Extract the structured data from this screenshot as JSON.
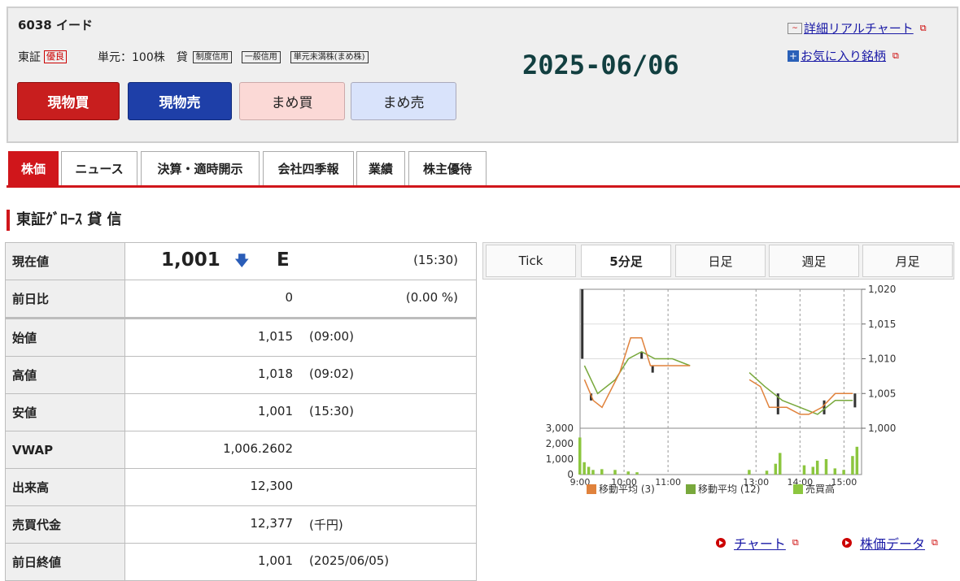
{
  "stock": {
    "code_name": "6038 イード",
    "market": "東証",
    "market_tag": "優良",
    "unit": "単元：100株",
    "lend_label": "貸",
    "tags": [
      "制度信用",
      "一般信用",
      "単元未満株(まめ株)"
    ]
  },
  "buttons": {
    "genbutsu_buy": "現物買",
    "genbutsu_sell": "現物売",
    "mame_buy": "まめ買",
    "mame_sell": "まめ売"
  },
  "date_stamp": "2025-06/06",
  "links": {
    "realtime_chart": "詳細リアルチャート",
    "favorite": "お気に入り銘柄",
    "chart": "チャート",
    "price_data": "株価データ"
  },
  "tabs": [
    "株価",
    "ニュース",
    "決算・適時開示",
    "会社四季報",
    "業績",
    "株主優待"
  ],
  "section_heading": "東証ｸﾞﾛｰｽ 貸 信",
  "quote": {
    "current": {
      "label": "現在値",
      "value": "1,001",
      "flag": "E",
      "time": "(15:30)"
    },
    "change": {
      "label": "前日比",
      "value": "0",
      "pct": "(0.00 %)"
    },
    "rows": [
      {
        "label": "始値",
        "value": "1,015",
        "paren": "(09:00)"
      },
      {
        "label": "高値",
        "value": "1,018",
        "paren": "(09:02)"
      },
      {
        "label": "安値",
        "value": "1,001",
        "paren": "(15:30)"
      },
      {
        "label": "VWAP",
        "value": "1,006.2602",
        "paren": ""
      },
      {
        "label": "出来高",
        "value": "12,300",
        "paren": ""
      },
      {
        "label": "売買代金",
        "value": "12,377",
        "paren": "(千円)"
      },
      {
        "label": "前日終値",
        "value": "1,001",
        "paren": "(2025/06/05)"
      }
    ]
  },
  "chart_tabs": [
    "Tick",
    "5分足",
    "日足",
    "週足",
    "月足"
  ],
  "chart_data": {
    "type": "line",
    "price_axis_ticks": [
      "1,020",
      "1,015",
      "1,010",
      "1,005",
      "1,000"
    ],
    "volume_axis_ticks": [
      "3,000",
      "2,000",
      "1,000",
      "0"
    ],
    "x_ticks": [
      "9:00",
      "10:00",
      "11:00",
      "13:00",
      "14:00",
      "15:00"
    ],
    "legend": [
      "移動平均 (3)",
      "移動平均 (12)",
      "売買高"
    ],
    "colors": {
      "ma3": "#e0823c",
      "ma12": "#78a83c",
      "volume": "#8cc63f"
    },
    "ylim_price": [
      1000,
      1020
    ],
    "ylim_volume": [
      0,
      3000
    ],
    "ma3": [
      [
        9.1,
        1007
      ],
      [
        9.3,
        1004
      ],
      [
        9.5,
        1003
      ],
      [
        9.9,
        1008
      ],
      [
        10.15,
        1013
      ],
      [
        10.4,
        1013
      ],
      [
        10.6,
        1009
      ],
      [
        10.8,
        1009
      ],
      [
        11.5,
        1009
      ],
      [
        12.85,
        1007
      ],
      [
        13.1,
        1006
      ],
      [
        13.3,
        1003
      ],
      [
        13.7,
        1003
      ],
      [
        14.0,
        1002
      ],
      [
        14.2,
        1002
      ],
      [
        14.5,
        1003
      ],
      [
        14.8,
        1005
      ],
      [
        15.2,
        1005
      ]
    ],
    "ma12": [
      [
        9.1,
        1009
      ],
      [
        9.4,
        1005
      ],
      [
        9.8,
        1007
      ],
      [
        10.1,
        1010
      ],
      [
        10.4,
        1011
      ],
      [
        10.7,
        1010
      ],
      [
        11.1,
        1010
      ],
      [
        11.5,
        1009
      ],
      [
        12.85,
        1008
      ],
      [
        13.2,
        1006
      ],
      [
        13.6,
        1004
      ],
      [
        14.0,
        1003
      ],
      [
        14.4,
        1002
      ],
      [
        14.8,
        1004
      ],
      [
        15.2,
        1004
      ]
    ],
    "volume": [
      [
        9.0,
        2400
      ],
      [
        9.1,
        800
      ],
      [
        9.2,
        500
      ],
      [
        9.3,
        300
      ],
      [
        9.5,
        350
      ],
      [
        9.8,
        300
      ],
      [
        10.1,
        200
      ],
      [
        10.3,
        150
      ],
      [
        12.85,
        300
      ],
      [
        13.25,
        250
      ],
      [
        13.45,
        700
      ],
      [
        13.55,
        1400
      ],
      [
        14.1,
        600
      ],
      [
        14.3,
        500
      ],
      [
        14.4,
        900
      ],
      [
        14.6,
        1000
      ],
      [
        14.8,
        400
      ],
      [
        15.0,
        300
      ],
      [
        15.2,
        1200
      ],
      [
        15.3,
        1800
      ]
    ]
  }
}
